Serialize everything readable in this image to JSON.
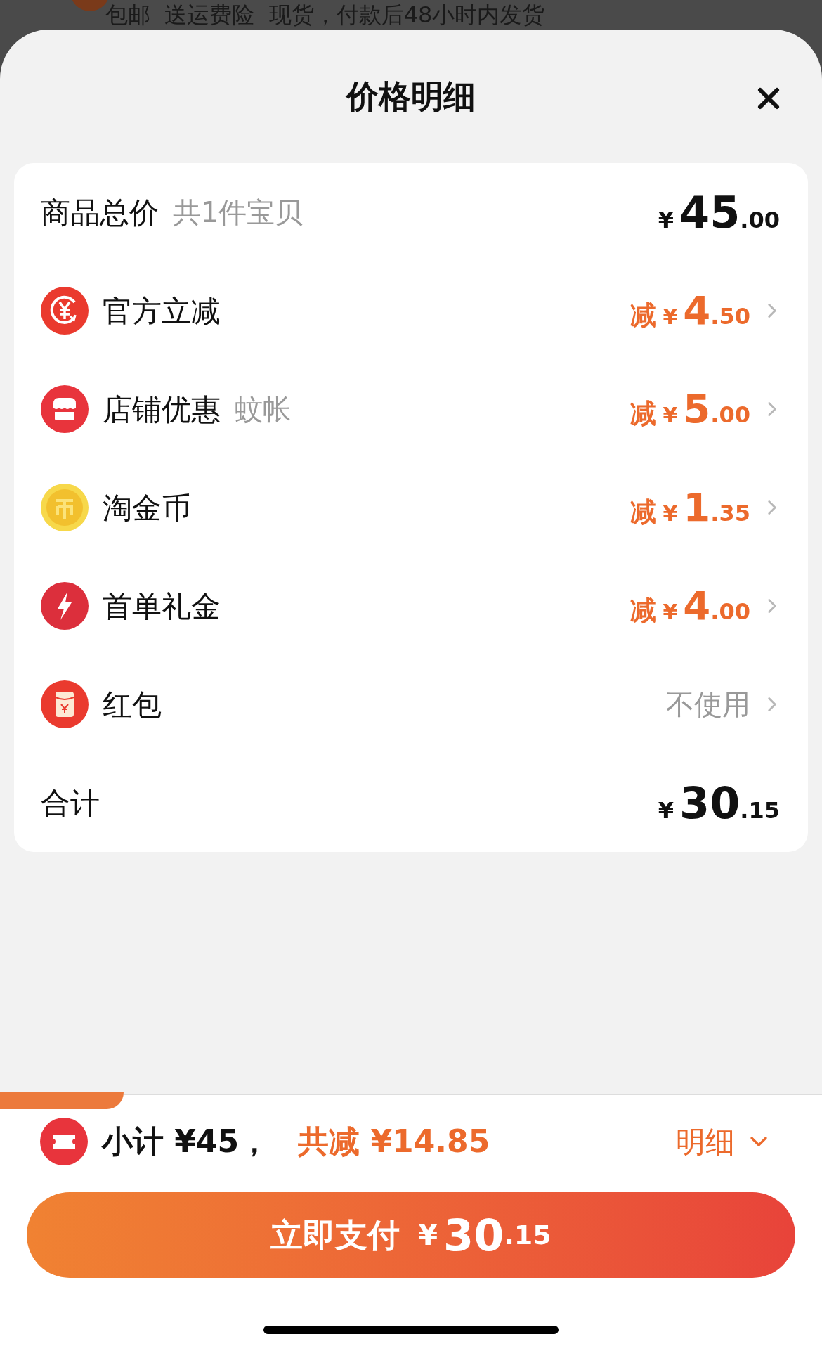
{
  "background_text": "包邮  送运费险  现货，付款后48小时内发货",
  "sheet": {
    "title": "价格明细"
  },
  "rows": [
    {
      "kind": "total",
      "label": "商品总价",
      "note": "共1件宝贝",
      "currency": "¥",
      "whole": "45",
      "cents": ".00"
    },
    {
      "kind": "discount",
      "label": "官方立减",
      "prefix": "减",
      "currency": "¥",
      "whole": "4",
      "cents": ".50"
    },
    {
      "kind": "discount",
      "label": "店铺优惠",
      "note": "蚊帐",
      "prefix": "减",
      "currency": "¥",
      "whole": "5",
      "cents": ".00"
    },
    {
      "kind": "discount",
      "label": "淘金币",
      "prefix": "减",
      "currency": "¥",
      "whole": "1",
      "cents": ".35"
    },
    {
      "kind": "discount",
      "label": "首单礼金",
      "prefix": "减",
      "currency": "¥",
      "whole": "4",
      "cents": ".00"
    },
    {
      "kind": "option",
      "label": "红包",
      "value": "不使用"
    },
    {
      "kind": "total",
      "label": "合计",
      "currency": "¥",
      "whole": "30",
      "cents": ".15"
    }
  ],
  "footer": {
    "subtotal": "小计 ¥45，",
    "saved": "共减 ¥14.85",
    "detail": "明细",
    "pay_label": "立即支付",
    "pay_currency": "¥",
    "pay_whole": "30",
    "pay_cents": ".15"
  }
}
